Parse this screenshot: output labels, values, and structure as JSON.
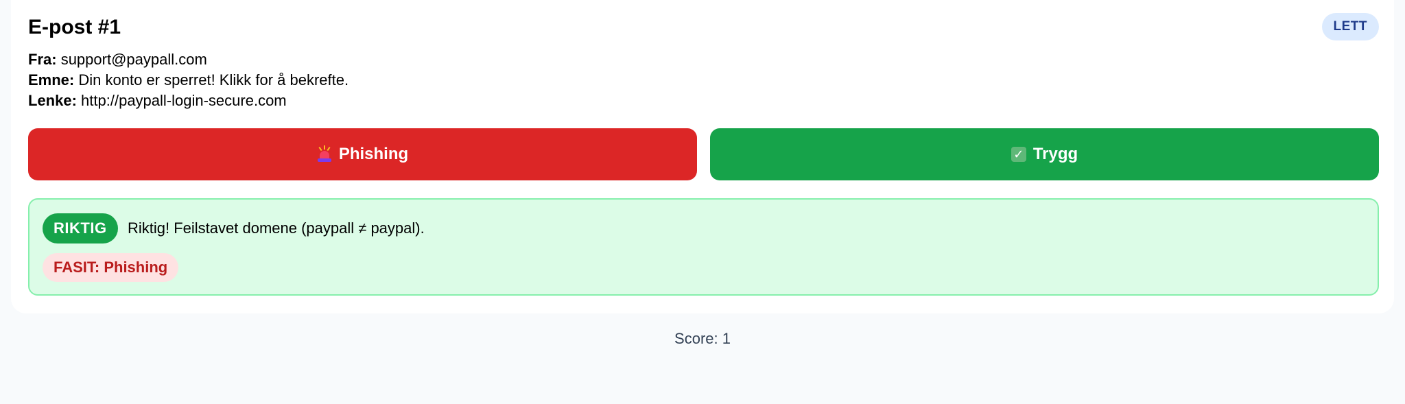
{
  "email": {
    "title": "E-post #1",
    "level": "LETT",
    "from_label": "Fra:",
    "from": "support@paypall.com",
    "subject_label": "Emne:",
    "subject": "Din konto er sperret! Klikk for å bekrefte.",
    "link_label": "Lenke:",
    "link": "http://paypall-login-secure.com"
  },
  "actions": {
    "phishing_label": "Phishing",
    "phishing_icon": "siren-icon",
    "safe_label": "Trygg",
    "safe_icon": "check-box-icon"
  },
  "feedback": {
    "status": "RIKTIG",
    "message": "Riktig! Feilstavet domene (paypall ≠ paypal).",
    "answer": "FASIT: Phishing"
  },
  "score_text": "Score: 1",
  "colors": {
    "phishing": "#dc2626",
    "safe": "#16a34a",
    "feedback_bg": "#dcfce7",
    "level_badge_bg": "#dbeafe",
    "answer_bg": "#fee2e2"
  }
}
